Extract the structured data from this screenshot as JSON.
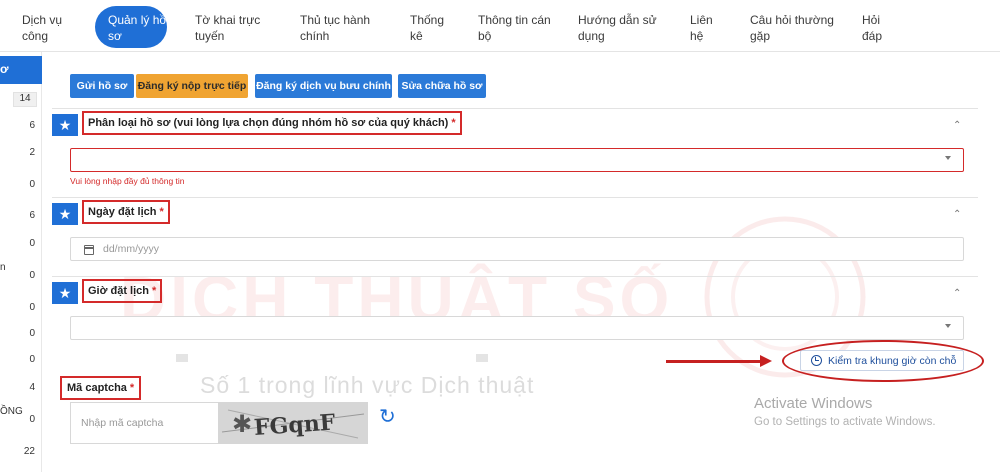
{
  "topnav": {
    "items": [
      {
        "label": "Dịch vụ\ncông"
      },
      {
        "label": "Quản lý hồ\nsơ"
      },
      {
        "label": "Tờ khai trực\ntuyến"
      },
      {
        "label": "Thủ tục hành\nchính"
      },
      {
        "label": "Thống\nkê"
      },
      {
        "label": "Thông tin cán\nbộ"
      },
      {
        "label": "Hướng dẫn sử\ndụng"
      },
      {
        "label": "Liên\nhệ"
      },
      {
        "label": "Câu hỏi thường\ngặp"
      },
      {
        "label": "Hỏi\nđáp"
      }
    ]
  },
  "sidebar": {
    "head": "ơ",
    "counts": [
      "14",
      "6",
      "2",
      "0",
      "6",
      "0",
      "0",
      "0",
      "0",
      "0",
      "4",
      "0",
      "22"
    ],
    "texts": [
      "n",
      "ỒNG"
    ]
  },
  "actions": {
    "submit": "Gửi hồ sơ",
    "direct": "Đăng ký nộp trực tiếp",
    "postal": "Đăng ký dịch vụ bưu chính",
    "edit": "Sửa chữa hồ sơ"
  },
  "sections": {
    "category": {
      "label": "Phân loại hồ sơ (vui lòng lựa chọn đúng nhóm hồ sơ của quý khách)",
      "required": "*",
      "error": "Vui lòng nhập đầy đủ thông tin"
    },
    "date": {
      "label": "Ngày đặt lịch",
      "required": "*",
      "placeholder": "dd/mm/yyyy"
    },
    "time": {
      "label": "Giờ đặt lịch",
      "required": "*",
      "check_button": "Kiểm tra khung giờ còn chỗ"
    },
    "captcha": {
      "label": "Mã captcha",
      "required": "*",
      "placeholder": "Nhập mã captcha",
      "image_text": "FGqnF"
    }
  },
  "os_overlay": {
    "title": "Activate Windows",
    "subtitle": "Go to Settings to activate Windows."
  },
  "watermark": {
    "main": "DỊCH THUẬT SỐ",
    "tagline": "Số 1 trong lĩnh vực Dịch thuật"
  },
  "colors": {
    "primary": "#1f6fd6",
    "orange": "#f0a432",
    "error": "#d42a2a"
  },
  "icons": {
    "star": "★",
    "chevron_up": "⌃",
    "refresh": "↻"
  }
}
